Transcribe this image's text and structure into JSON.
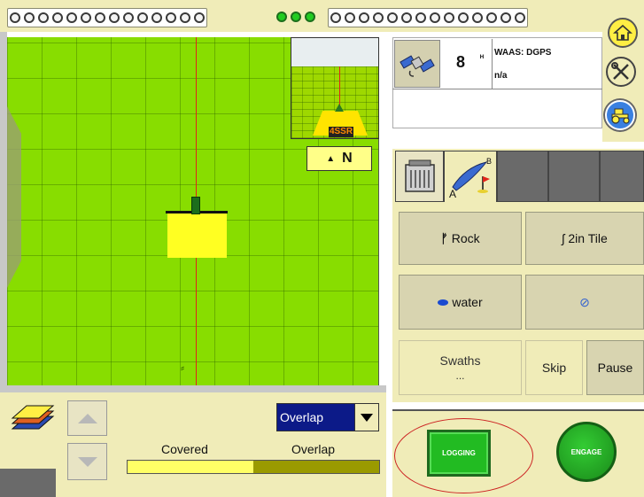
{
  "led_bar": {
    "group1_count": 14,
    "group2_count": 3,
    "group3_count": 14
  },
  "map": {
    "compass_label": "N",
    "mini_view_label": "4SSR"
  },
  "gps": {
    "satellite_count": "8",
    "signal_label": "WAAS: DGPS",
    "sub_status": "n/a"
  },
  "markers": {
    "rock": "Rock",
    "tile": "2in Tile",
    "water": "water",
    "none": "⊘",
    "swaths": "Swaths",
    "swaths_sub": "...",
    "skip": "Skip",
    "pause": "Pause"
  },
  "coverage": {
    "mode": "Overlap",
    "covered_label": "Covered",
    "overlap_label": "Overlap",
    "covered_fraction": 0.5
  },
  "controls": {
    "logging": "LOGGING",
    "engage": "ENGAGE"
  },
  "colors": {
    "field": "#88dd00",
    "panel": "#f0ecb8",
    "swath": "#ffff22",
    "guideline": "#e0241a",
    "engage": "#22bb22"
  }
}
